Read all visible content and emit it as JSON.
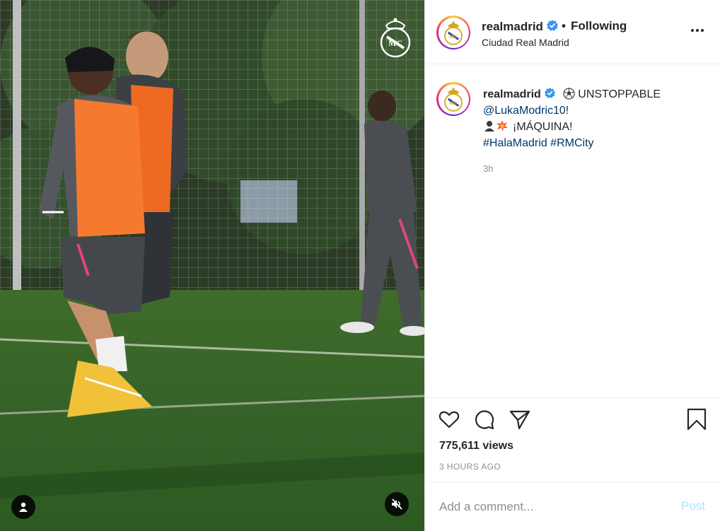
{
  "post": {
    "username": "realmadrid",
    "verified": true,
    "following_label": "Following",
    "separator": "•",
    "location": "Ciudad Real Madrid",
    "caption": {
      "username": "realmadrid",
      "line1": "UNSTOPPABLE",
      "mention": "@LukaModric10!",
      "line3": "¡MÁQUINA!",
      "hashtags": [
        "#HalaMadrid",
        "#RMCity"
      ]
    },
    "caption_time": "3h",
    "views": "775,611 views",
    "time_ago": "3 HOURS AGO"
  },
  "comment": {
    "placeholder": "Add a comment...",
    "post_label": "Post"
  },
  "icons": {
    "like": "heart-icon",
    "comment": "comment-icon",
    "share": "paper-plane-icon",
    "save": "bookmark-icon",
    "more": "ellipsis-icon",
    "tag": "user-tag-icon",
    "mute": "muted-speaker-icon",
    "verified": "verified-badge-icon",
    "football": "soccer-ball-icon",
    "bust": "bust-silhouette-icon",
    "collision": "collision-icon"
  },
  "colors": {
    "link": "#00376b",
    "verified": "#3897f0",
    "muted_text": "#8e8e8e",
    "post_disabled": "#b2dffc",
    "crest_gold": "#d9a520"
  }
}
